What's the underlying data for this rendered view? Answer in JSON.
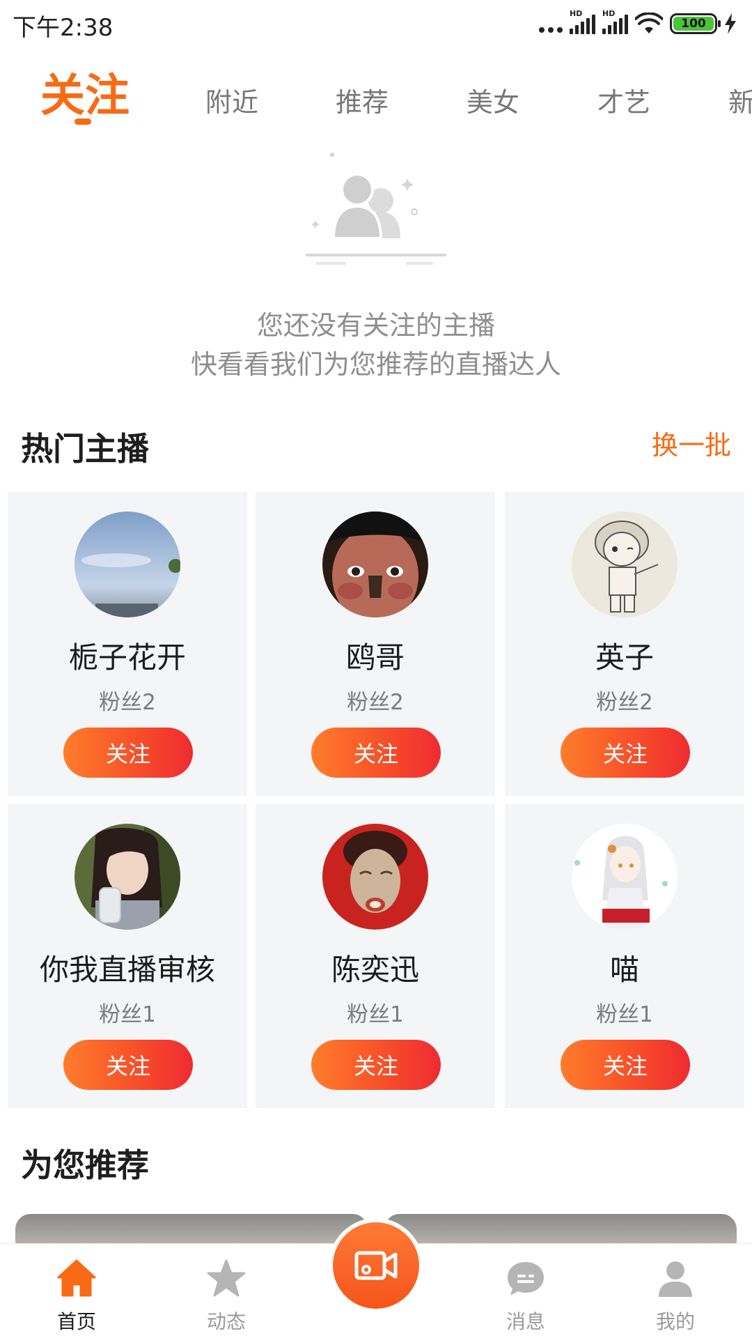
{
  "status_bar": {
    "time": "下午2:38",
    "hd_label": "HD",
    "battery_level": "100",
    "battery_color": "#49c538"
  },
  "tabs": [
    {
      "label": "关注",
      "active": true
    },
    {
      "label": "附近",
      "active": false
    },
    {
      "label": "推荐",
      "active": false
    },
    {
      "label": "美女",
      "active": false
    },
    {
      "label": "才艺",
      "active": false
    },
    {
      "label": "新",
      "active": false
    }
  ],
  "empty_state": {
    "icon": "users-empty-icon",
    "line1": "您还没有关注的主播",
    "line2": "快看看我们为您推荐的直播达人"
  },
  "hot_anchors": {
    "title": "热门主播",
    "refresh_label": "换一批",
    "items": [
      {
        "name": "栀子花开",
        "fans": "粉丝2",
        "follow_label": "关注"
      },
      {
        "name": "鸥哥",
        "fans": "粉丝2",
        "follow_label": "关注"
      },
      {
        "name": "英子",
        "fans": "粉丝2",
        "follow_label": "关注"
      },
      {
        "name": "你我直播审核",
        "fans": "粉丝1",
        "follow_label": "关注"
      },
      {
        "name": "陈奕迅",
        "fans": "粉丝1",
        "follow_label": "关注"
      },
      {
        "name": "喵",
        "fans": "粉丝1",
        "follow_label": "关注"
      }
    ]
  },
  "recommend": {
    "title": "为您推荐"
  },
  "bottom_nav": [
    {
      "label": "首页",
      "icon": "home-icon",
      "active": true
    },
    {
      "label": "动态",
      "icon": "star-icon",
      "active": false
    },
    {
      "label": "",
      "icon": "video-camera-icon",
      "active": false
    },
    {
      "label": "消息",
      "icon": "message-icon",
      "active": false
    },
    {
      "label": "我的",
      "icon": "profile-icon",
      "active": false
    }
  ],
  "colors": {
    "accent": "#f86a14",
    "follow_gradient_start": "#ff7d2b",
    "follow_gradient_end": "#ee2b32",
    "card_bg": "#f4f5f7",
    "inactive_icon": "#b5b5b5"
  }
}
